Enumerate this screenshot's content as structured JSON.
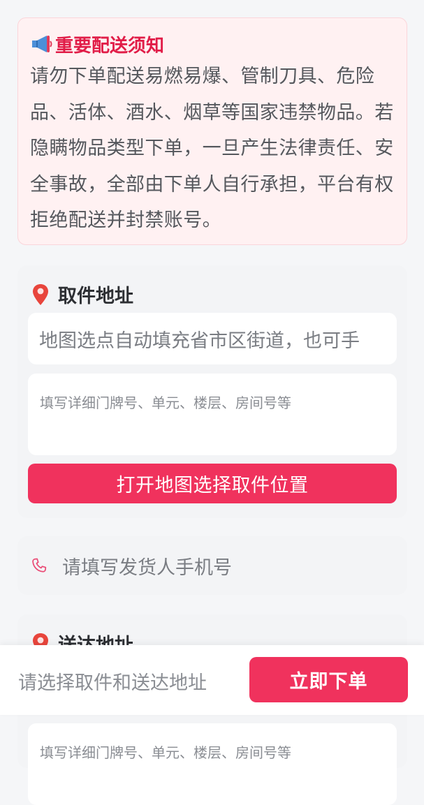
{
  "notice": {
    "icon": "megaphone-icon",
    "title": "重要配送须知",
    "body": "请勿下单配送易燃易爆、管制刀具、危险品、活体、酒水、烟草等国家违禁物品。若隐瞒物品类型下单，一旦产生法律责任、安全事故，全部由下单人自行承担，平台有权拒绝配送并封禁账号。"
  },
  "pickup": {
    "icon": "location-pin-icon",
    "title": "取件地址",
    "address_placeholder": "地图选点自动填充省市区街道，也可手",
    "detail_placeholder": "填写详细门牌号、单元、楼层、房间号等",
    "map_button_label": "打开地图选择取件位置"
  },
  "sender_phone": {
    "icon": "phone-icon",
    "placeholder": "请填写发货人手机号"
  },
  "delivery": {
    "icon": "location-pin-icon",
    "title": "送达地址",
    "detail_placeholder": "填写详细门牌号、单元、楼层、房间号等"
  },
  "bottom_bar": {
    "hint": "请选择取件和送达地址",
    "submit_label": "立即下单"
  },
  "colors": {
    "accent": "#f0325d",
    "notice_title": "#e11d48",
    "notice_background": "#fff1f2"
  }
}
